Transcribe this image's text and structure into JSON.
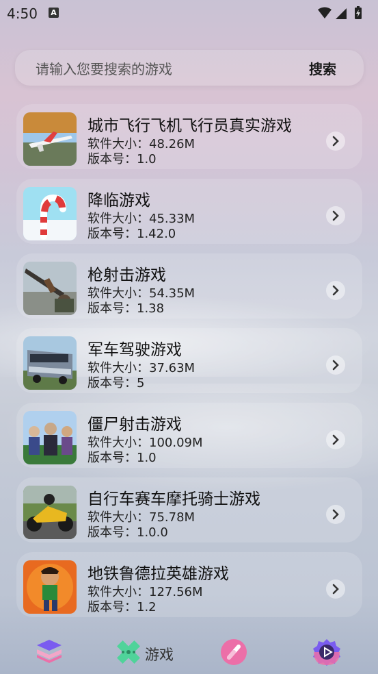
{
  "status_bar": {
    "time": "4:50",
    "notification_letter": "A"
  },
  "search": {
    "placeholder": "请输入您要搜索的游戏",
    "button_label": "搜索"
  },
  "games": [
    {
      "name": "城市飞行飞机飞行员真实游戏",
      "size": "软件大小：48.26M",
      "version": "版本号：1.0",
      "icon": "airplane-game-icon"
    },
    {
      "name": "降临游戏",
      "size": "软件大小：45.33M",
      "version": "版本号：1.42.0",
      "icon": "candy-cane-game-icon"
    },
    {
      "name": "枪射击游戏",
      "size": "软件大小：54.35M",
      "version": "版本号：1.38",
      "icon": "gun-game-icon"
    },
    {
      "name": "军车驾驶游戏",
      "size": "软件大小：37.63M",
      "version": "版本号：5",
      "icon": "army-bus-game-icon"
    },
    {
      "name": "僵尸射击游戏",
      "size": "软件大小：100.09M",
      "version": "版本号：1.0",
      "icon": "zombie-game-icon"
    },
    {
      "name": "自行车赛车摩托骑士游戏",
      "size": "软件大小：75.78M",
      "version": "版本号：1.0.0",
      "icon": "motorbike-game-icon"
    },
    {
      "name": "地铁鲁德拉英雄游戏",
      "size": "软件大小：127.56M",
      "version": "版本号：1.2",
      "icon": "subway-hero-game-icon"
    }
  ],
  "bottom_nav": {
    "tab_games_label": "游戏",
    "icons": [
      "layers-icon",
      "gamepad-icon",
      "pill-icon",
      "play-gear-icon"
    ]
  },
  "colors": {
    "accent_green": "#4fd39a",
    "accent_pink": "#ec6fa8",
    "nav_purple": "#7a5cf0"
  }
}
